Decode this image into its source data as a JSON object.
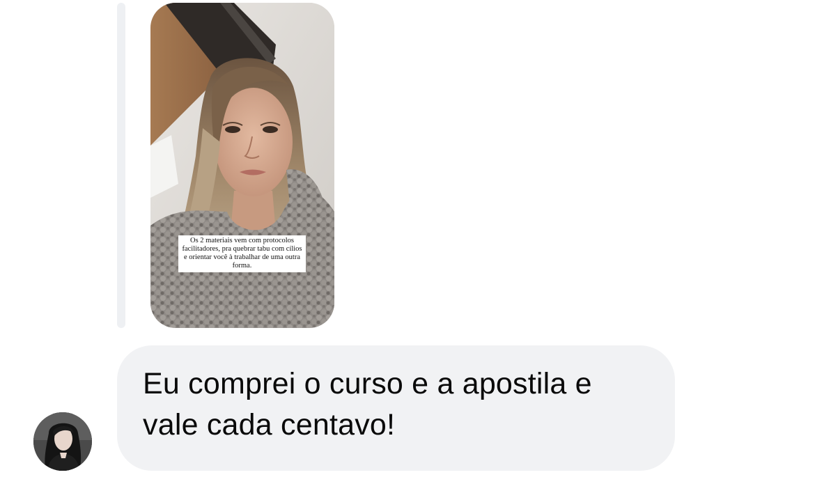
{
  "story_reply": {
    "caption": "Os 2 materiais vem com protocolos facilitadores, pra quebrar tabu com cílios e orientar você à trabalhar de uma outra forma."
  },
  "message": {
    "text": "Eu comprei o curso e a apostila e vale cada centavo!",
    "bubble_color": "#f1f2f4"
  },
  "sender": {
    "avatar_icon": "user-avatar-photo"
  }
}
